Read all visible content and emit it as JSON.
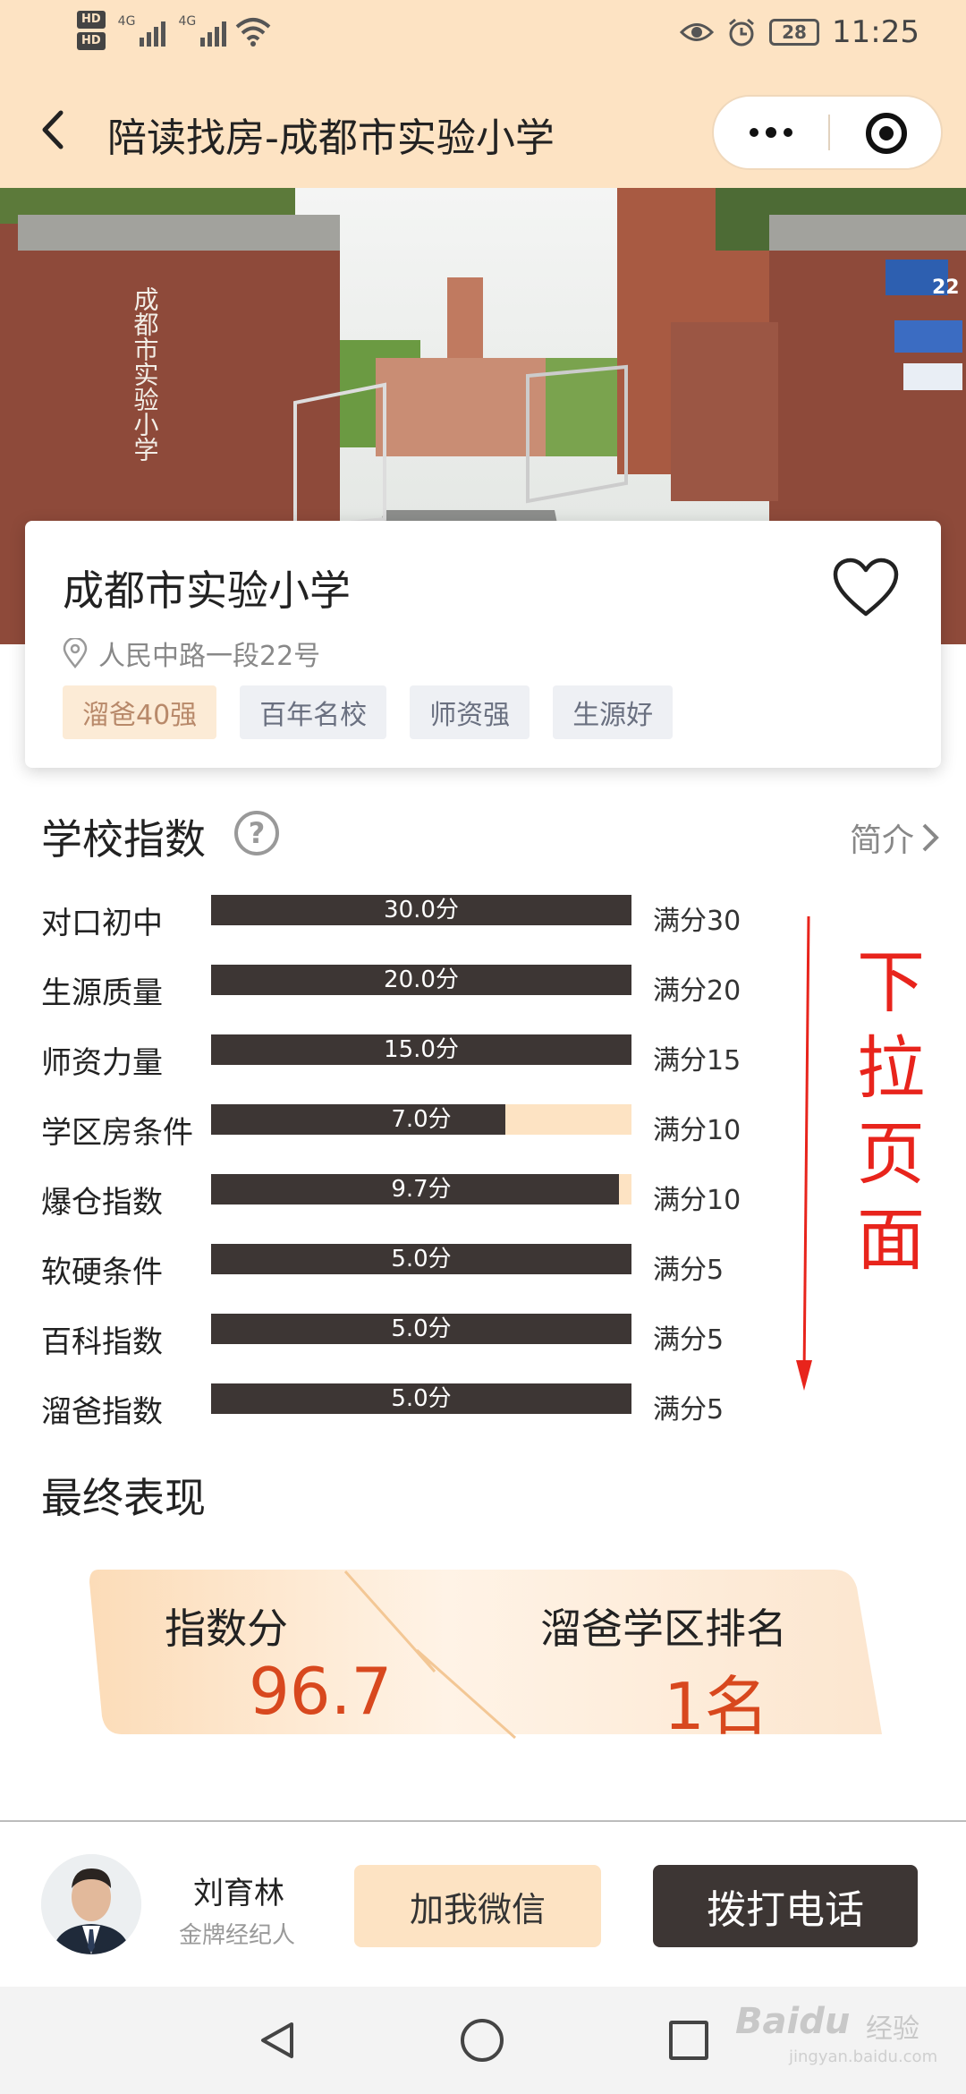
{
  "status_bar": {
    "hd1": "HD",
    "hd2": "HD",
    "net1": "4G",
    "net2": "4G",
    "battery": "28",
    "time": "11:25"
  },
  "nav": {
    "title": "陪读找房-成都市实验小学"
  },
  "banner": {
    "gate_text": "成都市实验小学",
    "plate": "22"
  },
  "school": {
    "name": "成都市实验小学",
    "address": "人民中路一段22号",
    "tags": [
      "溜爸40强",
      "百年名校",
      "师资强",
      "生源好"
    ]
  },
  "index_section": {
    "title": "学校指数",
    "intro_label": "简介",
    "help": "?"
  },
  "indices": [
    {
      "label": "对口初中",
      "score": 30.0,
      "score_text": "30.0分",
      "max_text": "满分30",
      "max": 30
    },
    {
      "label": "生源质量",
      "score": 20.0,
      "score_text": "20.0分",
      "max_text": "满分20",
      "max": 20
    },
    {
      "label": "师资力量",
      "score": 15.0,
      "score_text": "15.0分",
      "max_text": "满分15",
      "max": 15
    },
    {
      "label": "学区房条件",
      "score": 7.0,
      "score_text": "7.0分",
      "max_text": "满分10",
      "max": 10
    },
    {
      "label": "爆仓指数",
      "score": 9.7,
      "score_text": "9.7分",
      "max_text": "满分10",
      "max": 10
    },
    {
      "label": "软硬条件",
      "score": 5.0,
      "score_text": "5.0分",
      "max_text": "满分5",
      "max": 5
    },
    {
      "label": "百科指数",
      "score": 5.0,
      "score_text": "5.0分",
      "max_text": "满分5",
      "max": 5
    },
    {
      "label": "溜爸指数",
      "score": 5.0,
      "score_text": "5.0分",
      "max_text": "满分5",
      "max": 5
    }
  ],
  "annotation": {
    "text": "下拉页面"
  },
  "final": {
    "title": "最终表现",
    "index_label": "指数分",
    "index_value": "96.7",
    "rank_label": "溜爸学区排名",
    "rank_value": "1名"
  },
  "agent": {
    "name": "刘育林",
    "role": "金牌经纪人",
    "wechat_button": "加我微信",
    "call_button": "拨打电话"
  },
  "watermark": {
    "brand": "Baidu",
    "label": "经验",
    "url": "jingyan.baidu.com"
  },
  "colors": {
    "header_bg": "#fde3c3",
    "bar_fill": "#3d3634",
    "bar_track": "#fde3c3",
    "accent_red": "#d8481e",
    "annotation_red": "#e8241c"
  }
}
